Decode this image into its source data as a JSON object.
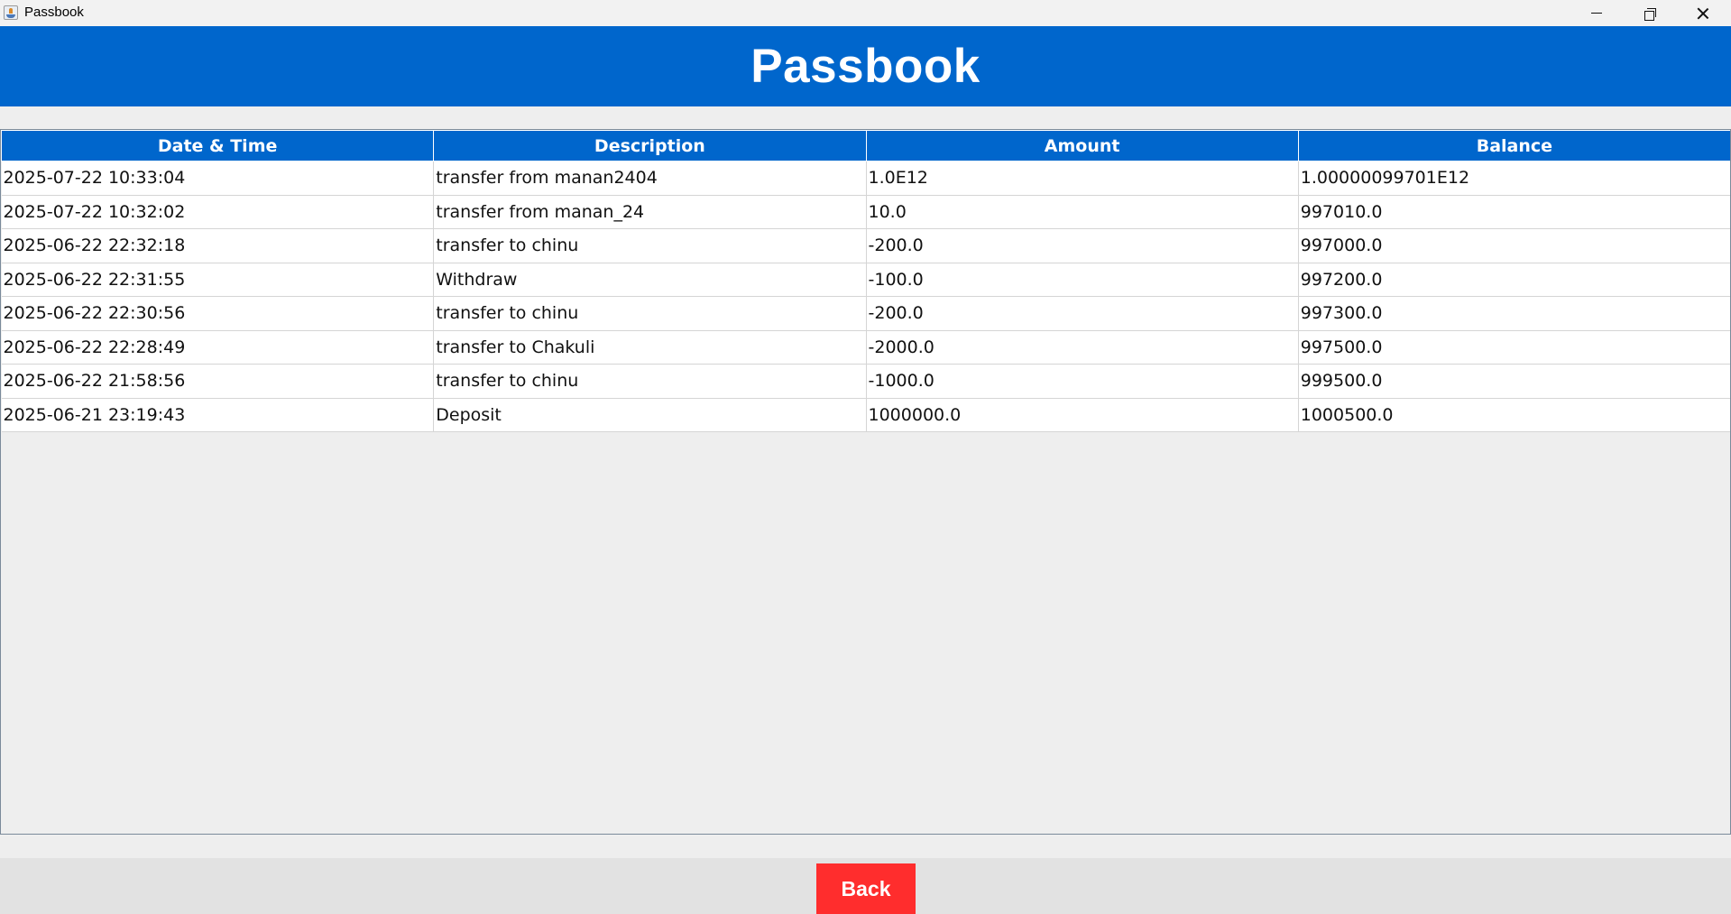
{
  "window": {
    "title": "Passbook",
    "app_icon": "java-cup-icon",
    "controls": [
      "minimize-icon",
      "maximize-icon",
      "close-icon"
    ]
  },
  "header": {
    "title": "Passbook",
    "background": "#0066cc"
  },
  "table": {
    "columns": [
      "Date & Time",
      "Description",
      "Amount",
      "Balance"
    ],
    "rows": [
      [
        "2025-07-22 10:33:04",
        "transfer from manan2404",
        "1.0E12",
        "1.00000099701E12"
      ],
      [
        "2025-07-22 10:32:02",
        "transfer from manan_24",
        "10.0",
        "997010.0"
      ],
      [
        "2025-06-22 22:32:18",
        "transfer to chinu",
        "-200.0",
        "997000.0"
      ],
      [
        "2025-06-22 22:31:55",
        "Withdraw",
        "-100.0",
        "997200.0"
      ],
      [
        "2025-06-22 22:30:56",
        "transfer to chinu",
        "-200.0",
        "997300.0"
      ],
      [
        "2025-06-22 22:28:49",
        "transfer to Chakuli",
        "-2000.0",
        "997500.0"
      ],
      [
        "2025-06-22 21:58:56",
        "transfer to chinu",
        "-1000.0",
        "999500.0"
      ],
      [
        "2025-06-21 23:19:43",
        "Deposit",
        "1000000.0",
        "1000500.0"
      ]
    ]
  },
  "footer": {
    "back_label": "Back",
    "back_color": "#ff2d2d"
  }
}
